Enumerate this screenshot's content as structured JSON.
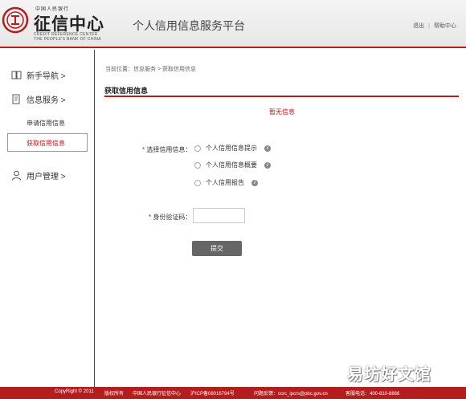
{
  "header": {
    "logo_top": "中国人民银行",
    "logo_main": "征信中心",
    "logo_en_line1": "CREDIT REFERENCE CENTER",
    "logo_en_line2": "THE PEOPLE'S BANK OF CHINA",
    "platform_title": "个人信用信息服务平台",
    "logout": "退出",
    "help": "帮助中心",
    "separator": "|"
  },
  "sidebar": {
    "guide": "新手导航 >",
    "info_service": "信息服务 >",
    "apply_credit": "申请信用信息",
    "get_credit": "获取信用信息",
    "user_mgmt": "用户管理 >"
  },
  "main": {
    "breadcrumb": "当前位置：信息服务 > 获取信用信息",
    "section_title": "获取信用信息",
    "no_info": "暂无信息",
    "select_label_star": "*",
    "select_label": " 选择信用信息：",
    "options": [
      "个人信用信息提示",
      "个人信用信息概要",
      "个人信用报告"
    ],
    "id_label_star": "*",
    "id_label": " 身份验证码：",
    "id_value": "",
    "submit": "提交",
    "info_glyph": "i"
  },
  "footer": {
    "copyright": "CopyRight © 2011",
    "rights": "版权所有",
    "org": "中国人民银行征信中心",
    "icp": "沪ICP备08016794号",
    "feedback": "问题反馈：ccrc_ipcrs@pbc.gov.cn",
    "phone": "客服电话：400-810-8866"
  },
  "watermark": "易坊好文馆",
  "colors": {
    "brand_red": "#b51d1d",
    "link_red": "#c0151b",
    "button_gray": "#666666"
  }
}
